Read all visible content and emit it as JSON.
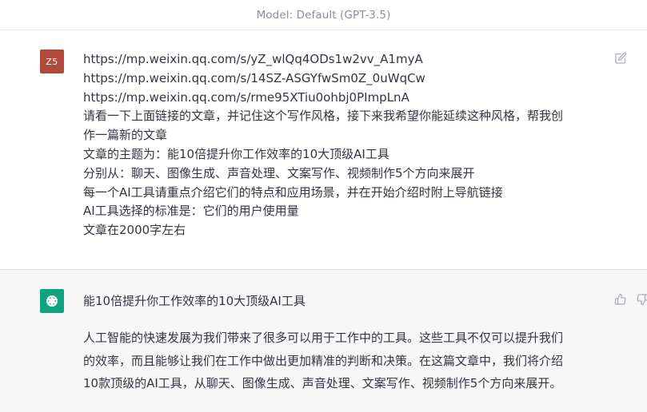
{
  "header": {
    "model_label": "Model: Default (GPT-3.5)"
  },
  "user_message": {
    "avatar_initials": "Z5",
    "lines": [
      "https://mp.weixin.qq.com/s/yZ_wlQq4ODs1w2vv_A1myA",
      "https://mp.weixin.qq.com/s/14SZ-ASGYfwSm0Z_0uWqCw",
      "https://mp.weixin.qq.com/s/rme95XTiu0ohbj0PImpLnA",
      "请看一下上面链接的文章，并记住这个写作风格，接下来我希望你能延续这种风格，帮我创",
      "作一篇新的文章",
      "文章的主题为：能10倍提升你工作效率的10大顶级AI工具",
      "分别从：聊天、图像生成、声音处理、文案写作、视频制作5个方向来展开",
      "每一个AI工具请重点介绍它们的特点和应用场景，并在开始介绍时附上导航链接",
      "AI工具选择的标准是：它们的用户使用量",
      "文章在2000字左右"
    ],
    "edit_icon": "edit-icon"
  },
  "assistant_message": {
    "avatar_icon": "openai-logo-icon",
    "title": "能10倍提升你工作效率的10大顶级AI工具",
    "paragraph_lines": [
      "人工智能的快速发展为我们带来了很多可以用于工作中的工具。这些工具不仅可以提升我们",
      "的效率，而且能够让我们在工作中做出更加精准的判断和决策。在这篇文章中，我们将介绍",
      "10款顶级的AI工具，从聊天、图像生成、声音处理、文案写作、视频制作5个方向来展开。"
    ],
    "thumb_up_icon": "thumbs-up-icon",
    "thumb_down_icon": "thumbs-down-icon"
  },
  "colors": {
    "user_avatar": "#b24a3b",
    "bot_avatar": "#10a37f",
    "assistant_bg": "#f7f7f8",
    "text": "#343541",
    "muted": "#8e8ea0"
  }
}
